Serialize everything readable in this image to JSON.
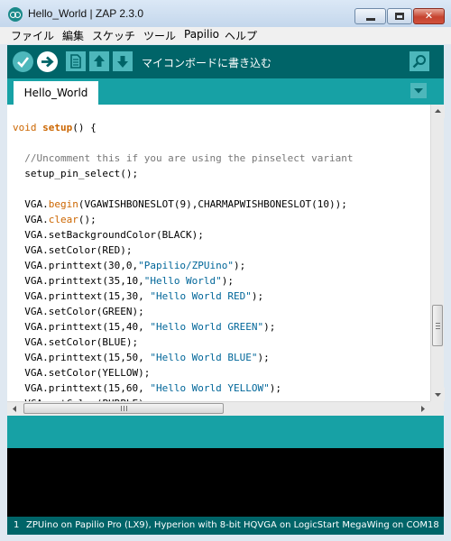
{
  "window": {
    "title": "Hello_World | ZAP 2.3.0",
    "minimize_glyph": "",
    "close_glyph": "✕"
  },
  "menu": [
    "ファイル",
    "編集",
    "スケッチ",
    "ツール",
    "Papilio",
    "ヘルプ"
  ],
  "toolbar": {
    "hover_label": "マイコンボードに書き込む"
  },
  "tabs": [
    {
      "label": "Hello_World"
    }
  ],
  "editor": {
    "lines": [
      [
        [
          "void",
          "kw"
        ],
        [
          " ",
          ""
        ],
        [
          "setup",
          "kw-bold"
        ],
        [
          "() {",
          ""
        ]
      ],
      [],
      [
        [
          "  //Uncomment this if you are using the pinselect variant",
          "cm"
        ]
      ],
      [
        [
          "  setup_pin_select();",
          ""
        ]
      ],
      [],
      [
        [
          "  VGA.",
          ""
        ],
        [
          "begin",
          "fn"
        ],
        [
          "(VGAWISHBONESLOT(9),CHARMAPWISHBONESLOT(10));",
          ""
        ]
      ],
      [
        [
          "  VGA.",
          ""
        ],
        [
          "clear",
          "fn"
        ],
        [
          "();",
          ""
        ]
      ],
      [
        [
          "  VGA.setBackgroundColor(BLACK);",
          ""
        ]
      ],
      [
        [
          "  VGA.setColor(RED);",
          ""
        ]
      ],
      [
        [
          "  VGA.printtext(30,0,",
          ""
        ],
        [
          "\"Papilio/ZPUino\"",
          "str"
        ],
        [
          ");",
          ""
        ]
      ],
      [
        [
          "  VGA.printtext(35,10,",
          ""
        ],
        [
          "\"Hello World\"",
          "str"
        ],
        [
          ");",
          ""
        ]
      ],
      [
        [
          "  VGA.printtext(15,30, ",
          ""
        ],
        [
          "\"Hello World RED\"",
          "str"
        ],
        [
          ");",
          ""
        ]
      ],
      [
        [
          "  VGA.setColor(GREEN);",
          ""
        ]
      ],
      [
        [
          "  VGA.printtext(15,40, ",
          ""
        ],
        [
          "\"Hello World GREEN\"",
          "str"
        ],
        [
          ");",
          ""
        ]
      ],
      [
        [
          "  VGA.setColor(BLUE);",
          ""
        ]
      ],
      [
        [
          "  VGA.printtext(15,50, ",
          ""
        ],
        [
          "\"Hello World BLUE\"",
          "str"
        ],
        [
          ");",
          ""
        ]
      ],
      [
        [
          "  VGA.setColor(YELLOW);",
          ""
        ]
      ],
      [
        [
          "  VGA.printtext(15,60, ",
          ""
        ],
        [
          "\"Hello World YELLOW\"",
          "str"
        ],
        [
          ");",
          ""
        ]
      ],
      [
        [
          "  VGA.setColor(PURPLE);",
          ""
        ]
      ]
    ]
  },
  "status": {
    "line_number": "1",
    "board": "ZPUino on Papilio Pro (LX9), Hyperion with 8-bit HQVGA on LogicStart MegaWing on COM18"
  },
  "colors": {
    "toolbar_dark": "#006468",
    "teal": "#17a1a5",
    "button": "#4db7bb",
    "keyword": "#cc6600",
    "string": "#006699",
    "comment": "#777777"
  },
  "icons": {
    "verify": "check-icon",
    "upload": "arrow-right-icon",
    "new": "document-icon",
    "open": "arrow-up-icon",
    "save": "arrow-down-icon",
    "serial_monitor": "magnifier-icon",
    "tab_menu": "triangle-down-icon"
  }
}
